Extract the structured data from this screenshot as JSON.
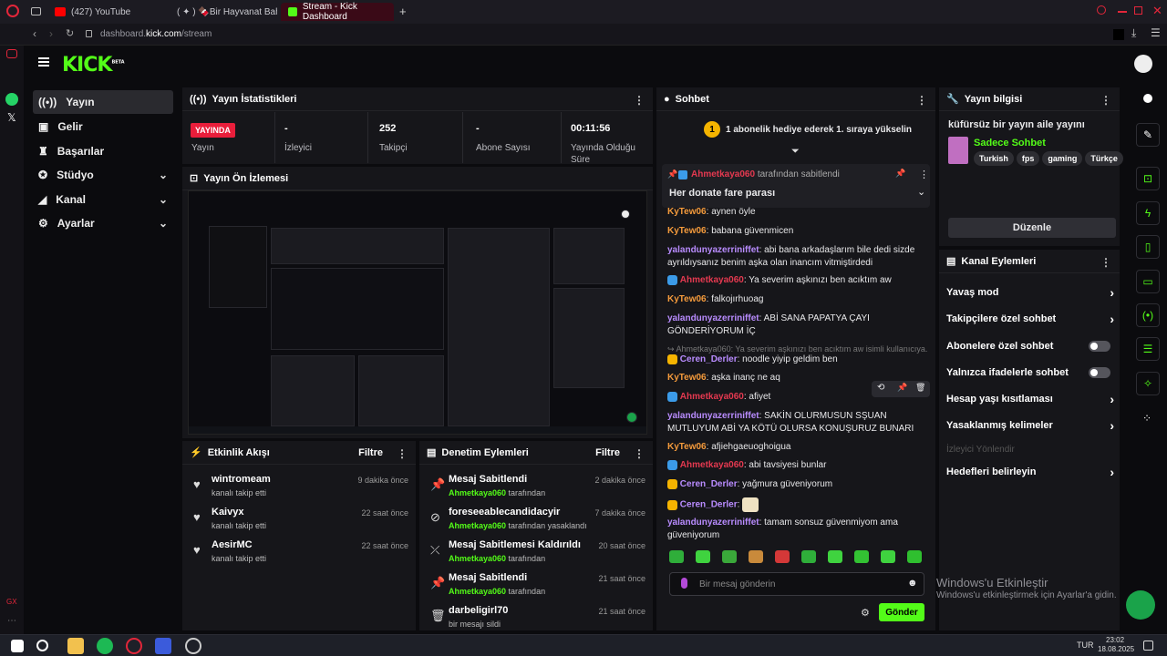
{
  "browser": {
    "tabs": [
      {
        "label": "(427) YouTube"
      },
      {
        "label": "( ✦ ) 🍫Bir Hayvanat Bah"
      },
      {
        "label": "Stream - Kick Dashboard"
      }
    ],
    "new_tab": "+",
    "url_prefix": "dashboard.",
    "url_domain": "kick.com",
    "url_path": "/stream"
  },
  "kick": {
    "logo": "KICK",
    "logo_sup": "BETA"
  },
  "nav": [
    {
      "label": "Yayın",
      "icon": "broadcast-icon",
      "selected": true,
      "expand": false
    },
    {
      "label": "Gelir",
      "icon": "wallet-icon",
      "expand": false
    },
    {
      "label": "Başarılar",
      "icon": "trophy-icon",
      "expand": false
    },
    {
      "label": "Stüdyo",
      "icon": "studio-icon",
      "expand": true
    },
    {
      "label": "Kanal",
      "icon": "channel-icon",
      "expand": true
    },
    {
      "label": "Ayarlar",
      "icon": "gear-icon",
      "expand": true
    }
  ],
  "stats": {
    "title": "Yayın İstatistikleri",
    "live_badge": "YAYINDA",
    "live_label": "Yayın",
    "viewers_value": "-",
    "viewers_label": "İzleyici",
    "followers_value": "252",
    "followers_label": "Takipçi",
    "subs_value": "-",
    "subs_label": "Abone Sayısı",
    "uptime_value": "00:11:56",
    "uptime_label": "Yayında Olduğu Süre"
  },
  "preview": {
    "title": "Yayın Ön İzlemesi"
  },
  "activity": {
    "title": "Etkinlik Akışı",
    "filter": "Filtre",
    "items": [
      {
        "name": "wintromeam",
        "desc": "kanalı takip etti",
        "time": "9 dakika önce"
      },
      {
        "name": "Kaivyx",
        "desc": "kanalı takip etti",
        "time": "22 saat önce"
      },
      {
        "name": "AesirMC",
        "desc": "kanalı takip etti",
        "time": "22 saat önce"
      }
    ]
  },
  "moderation": {
    "title": "Denetim Eylemleri",
    "filter": "Filtre",
    "items": [
      {
        "title": "Mesaj Sabitlendi",
        "user": "Ahmetkaya060",
        "rest": " tarafından",
        "time": "2 dakika önce",
        "icon": "pin-icon"
      },
      {
        "title": "foreseeablecandidacyir",
        "user": "Ahmetkaya060",
        "rest": " tarafından yasaklandı",
        "time": "7 dakika önce",
        "icon": "ban-icon"
      },
      {
        "title": "Mesaj Sabitlemesi Kaldırıldı",
        "user": "Ahmetkaya060",
        "rest": " tarafından",
        "time": "20 saat önce",
        "icon": "unpin-icon"
      },
      {
        "title": "Mesaj Sabitlendi",
        "user": "Ahmetkaya060",
        "rest": " tarafından",
        "time": "21 saat önce",
        "icon": "pin-icon"
      },
      {
        "title": "darbeligirl70",
        "user": "",
        "rest": "bir mesajı sildi",
        "time": "21 saat önce",
        "icon": "trash-icon"
      }
    ]
  },
  "chat": {
    "title": "Sohbet",
    "goal": "1 abonelik hediye ederek 1. sıraya yükselin",
    "goal_rank": "1",
    "pinned_user": "Ahmetkaya060",
    "pinned_by": " tarafından sabitlendi",
    "pinned_text": "Her donate fare parası",
    "reply_ref": "↪ Ahmetkaya060: Ya severim aşkınızı ben acıktım aw isimli kullanıcıya...",
    "input_placeholder": "Bir mesaj gönderin",
    "send": "Gönder",
    "messages": [
      {
        "user": "KyTew06",
        "text": "aynen öyle",
        "color": "#f59b3c"
      },
      {
        "user": "KyTew06",
        "text": "babana güvenmicen",
        "color": "#f59b3c"
      },
      {
        "user": "yalandunyazerriniffet",
        "text": "abi bana arkadaşlarım bile dedi sizde ayrıldıysanız benim aşka olan inancım vitmiştirdedi",
        "color": "#b98cff"
      },
      {
        "user": "Ahmetkaya060",
        "text": "Ya severim aşkınızı ben acıktım aw",
        "color": "#e53950"
      },
      {
        "user": "KyTew06",
        "text": "falkojırhuoag",
        "color": "#f59b3c"
      },
      {
        "user": "yalandunyazerriniffet",
        "text": "ABİ SANA PAPATYA ÇAYI GÖNDERİYORUM İÇ",
        "color": "#b98cff"
      },
      {
        "user": "Ceren_Derler",
        "text": "noodle yiyip geldim ben",
        "color": "#b98cff"
      },
      {
        "user": "KyTew06",
        "text": "aşka inanç ne aq",
        "color": "#f59b3c"
      },
      {
        "user": "Ahmetkaya060",
        "text": "afiyet",
        "color": "#e53950"
      },
      {
        "user": "yalandunyazerriniffet",
        "text": "SAKİN OLURMUSUN SŞUAN MUTLUYUM ABİ YA KÖTÜ OLURSA KONUŞURUZ BUNARI",
        "color": "#b98cff"
      },
      {
        "user": "KyTew06",
        "text": "afjiehgaeuoghoigua",
        "color": "#f59b3c"
      },
      {
        "user": "Ahmetkaya060",
        "text": "abi tavsiyesi bunlar",
        "color": "#e53950"
      },
      {
        "user": "Ceren_Derler",
        "text": "yağmura güveniyorum",
        "color": "#b98cff"
      },
      {
        "user": "Ceren_Derler",
        "text": "",
        "color": "#b98cff"
      },
      {
        "user": "yalandunyazerriniffet",
        "text": "tamam sonsuz güvenmiyom ama güveniyorum",
        "color": "#b98cff"
      }
    ]
  },
  "info": {
    "title": "Yayın bilgisi",
    "stream_title": "küfürsüz bir yayın aile yayını",
    "category": "Sadece Sohbet",
    "tags": [
      "Turkish",
      "fps",
      "gaming",
      "Türkçe"
    ],
    "edit": "Düzenle"
  },
  "actions": {
    "title": "Kanal Eylemleri",
    "items": [
      {
        "label": "Yavaş mod",
        "kind": "arrow"
      },
      {
        "label": "Takipçilere özel sohbet",
        "kind": "arrow"
      },
      {
        "label": "Abonelere özel sohbet",
        "kind": "toggle"
      },
      {
        "label": "Yalnızca ifadelerle sohbet",
        "kind": "toggle"
      },
      {
        "label": "Hesap yaşı kısıtlaması",
        "kind": "arrow"
      },
      {
        "label": "Yasaklanmış kelimeler",
        "kind": "arrow"
      },
      {
        "label": "İzleyici Yönlendir",
        "kind": "disabled"
      },
      {
        "label": "Hedefleri belirleyin",
        "kind": "arrow"
      }
    ]
  },
  "watermark": {
    "line1": "Windows'u Etkinleştir",
    "line2": "Windows'u etkinleştirmek için Ayarlar'a gidin."
  },
  "taskbar": {
    "lang": "TUR",
    "time": "23:02",
    "date": "18.08.2025"
  },
  "colors": {
    "kick_green": "#53fc18",
    "live_red": "#e91e3b",
    "panel": "#16161a"
  }
}
